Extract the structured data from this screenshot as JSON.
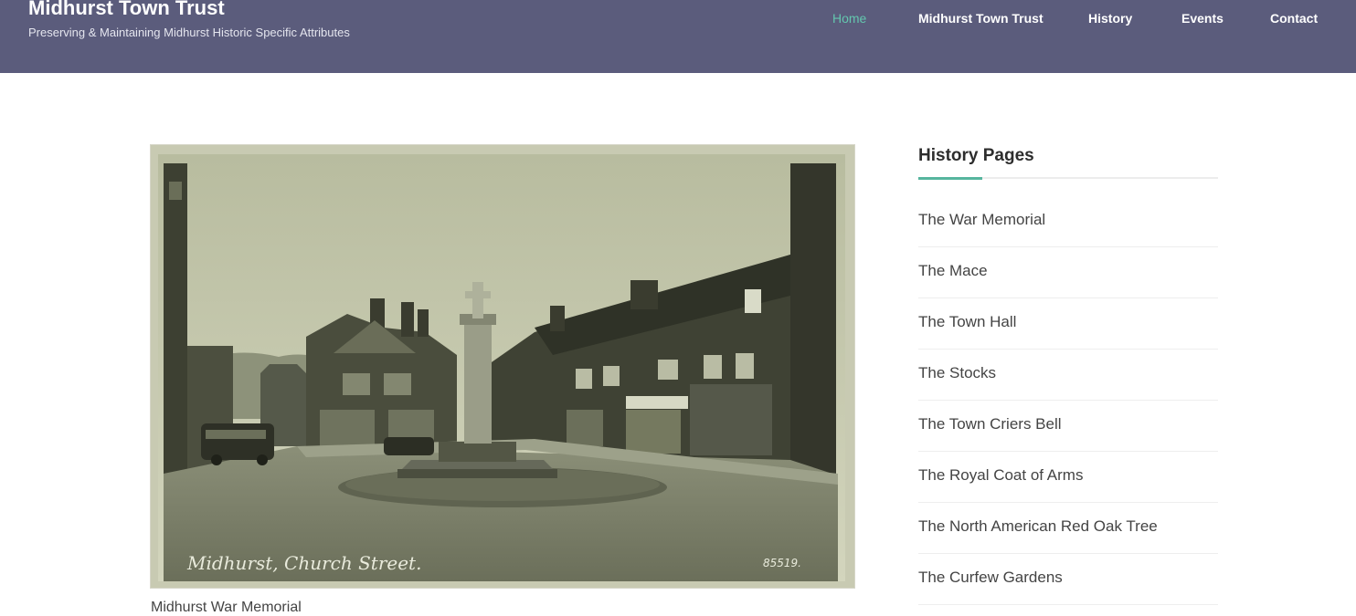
{
  "site": {
    "title": "Midhurst Town Trust",
    "tagline": "Preserving & Maintaining Midhurst Historic Specific Attributes"
  },
  "nav": {
    "items": [
      {
        "label": "Home",
        "active": true
      },
      {
        "label": "Midhurst Town Trust",
        "active": false
      },
      {
        "label": "History",
        "active": false
      },
      {
        "label": "Events",
        "active": false
      },
      {
        "label": "Contact",
        "active": false
      }
    ]
  },
  "main": {
    "photo": {
      "inscription": "Midhurst, Church Street.",
      "number": "85519."
    },
    "caption": "Midhurst War Memorial"
  },
  "sidebar": {
    "title": "History Pages",
    "items": [
      {
        "label": "The War Memorial"
      },
      {
        "label": "The Mace"
      },
      {
        "label": "The Town Hall"
      },
      {
        "label": "The Stocks"
      },
      {
        "label": "The Town Criers Bell"
      },
      {
        "label": "The Royal Coat of Arms"
      },
      {
        "label": "The North American Red Oak Tree"
      },
      {
        "label": "The Curfew Gardens"
      }
    ]
  },
  "colors": {
    "header_bg": "#5b5c7c",
    "nav_active": "#63c6ae",
    "accent_rule": "#56b59e"
  }
}
